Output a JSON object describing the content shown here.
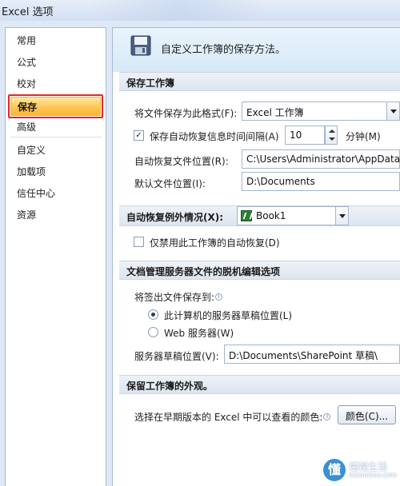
{
  "window": {
    "title": "Excel 选项"
  },
  "nav": {
    "items": [
      "常用",
      "公式",
      "校对",
      "保存",
      "高级",
      "自定义",
      "加载项",
      "信任中心",
      "资源"
    ],
    "selected": "保存"
  },
  "header": {
    "text": "自定义工作簿的保存方法。",
    "icon": "floppy-disk-icon"
  },
  "save_workbooks": {
    "section_title": "保存工作簿",
    "format_label": "将文件保存为此格式(F):",
    "format_value": "Excel 工作簿",
    "autorecover_checked": true,
    "autorecover_label": "保存自动恢复信息时间间隔(A)",
    "autorecover_minutes": "10",
    "minutes_label": "分钟(M)",
    "autorecover_location_label": "自动恢复文件位置(R):",
    "autorecover_location_value": "C:\\Users\\Administrator\\AppData\\",
    "default_location_label": "默认文件位置(I):",
    "default_location_value": "D:\\Documents"
  },
  "autorecover_exceptions": {
    "section_title": "自动恢复例外情况(X):",
    "workbook": "Book1",
    "disable_checked": false,
    "disable_label": "仅禁用此工作簿的自动恢复(D)"
  },
  "offline_editing": {
    "section_title": "文档管理服务器文件的脱机编辑选项",
    "save_checked_out_label": "将签出文件保存到:",
    "option_local": "此计算机的服务器草稿位置(L)",
    "option_web": "Web 服务器(W)",
    "selected_option": "local",
    "drafts_location_label": "服务器草稿位置(V):",
    "drafts_location_value": "D:\\Documents\\SharePoint 草稿\\"
  },
  "preserve_appearance": {
    "section_title": "保留工作簿的外观。",
    "colors_label": "选择在早期版本的 Excel 中可以查看的颜色:",
    "colors_button": "颜色(C)..."
  },
  "watermark": {
    "logo_char": "懂",
    "name": "懂视生活",
    "domain": "DIDONGSHI.COM"
  },
  "colors": {
    "selected_outline": "#e0272b",
    "selected_fill": "#fdc655",
    "frame": "#dfe8f5"
  }
}
